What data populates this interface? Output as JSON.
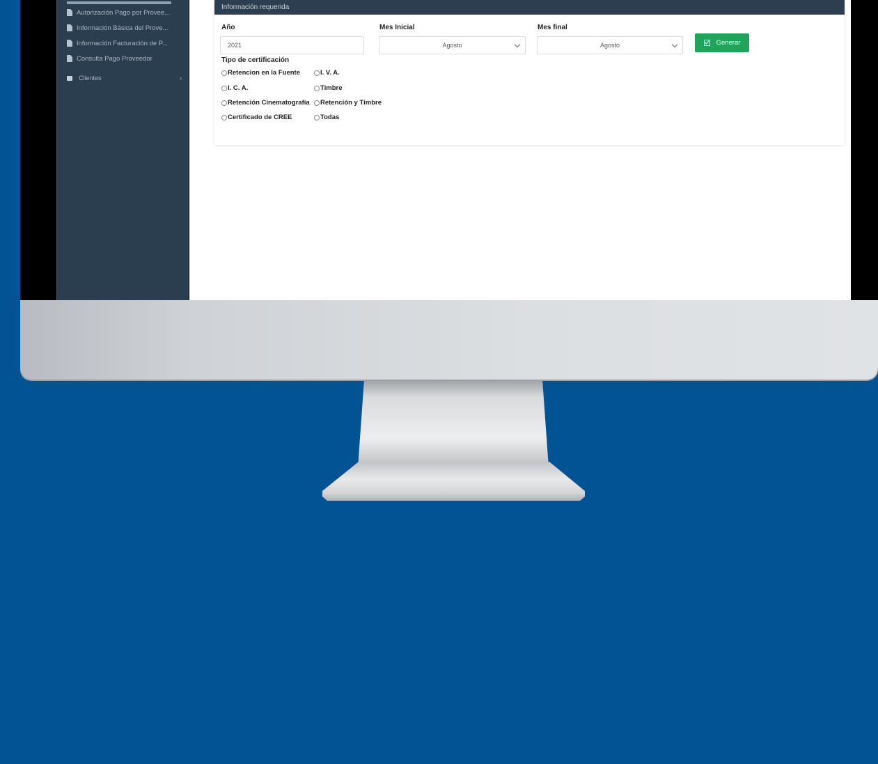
{
  "sidebar": {
    "items": [
      {
        "label": "Autorización Pago por Provee..."
      },
      {
        "label": "Información Básica del Prove..."
      },
      {
        "label": "Información Facturación de P..."
      },
      {
        "label": "Consulta Pago Proveedor"
      }
    ],
    "folder": {
      "label": "Clientes",
      "chevron": "›"
    }
  },
  "panel": {
    "header": "Información requerida",
    "year_label": "Año",
    "year_value": "2021",
    "mes_inicial_label": "Mes Inicial",
    "mes_inicial_value": "Agosto",
    "mes_final_label": "Mes final",
    "mes_final_value": "Agosto",
    "generar_label": "Generar",
    "tipo_label": "Tipo de certificación",
    "options": [
      "Retencion en la Fuente",
      "I. V. A.",
      "I. C. A.",
      "Timbre",
      "Retención Cinematografía",
      "Retención y Timbre",
      "Certificado de CREE",
      "Todas"
    ]
  },
  "colors": {
    "background": "#015394",
    "sidebar": "#2b3e50",
    "panel_header": "#2d3e50",
    "generar_button": "#21a35b"
  }
}
